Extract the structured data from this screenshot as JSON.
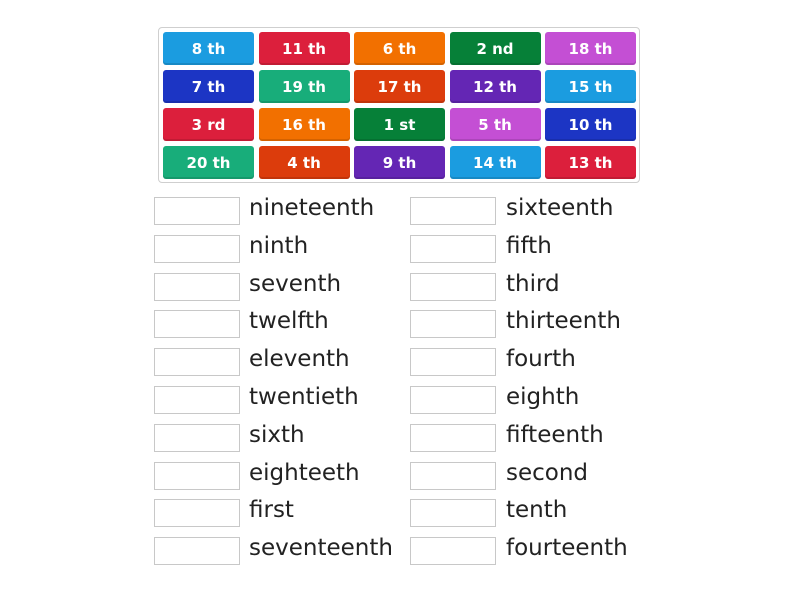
{
  "tiles": [
    {
      "label": "8 th",
      "color": "#1b9ce0"
    },
    {
      "label": "11 th",
      "color": "#dc1f3c"
    },
    {
      "label": "6 th",
      "color": "#f27000"
    },
    {
      "label": "2 nd",
      "color": "#068038"
    },
    {
      "label": "18 th",
      "color": "#c44fd4"
    },
    {
      "label": "7 th",
      "color": "#1c35c4"
    },
    {
      "label": "19 th",
      "color": "#18ad7a"
    },
    {
      "label": "17 th",
      "color": "#dc3c0c"
    },
    {
      "label": "12 th",
      "color": "#6426b4"
    },
    {
      "label": "15 th",
      "color": "#1b9ce0"
    },
    {
      "label": "3 rd",
      "color": "#dc1f3c"
    },
    {
      "label": "16 th",
      "color": "#f27000"
    },
    {
      "label": "1 st",
      "color": "#068038"
    },
    {
      "label": "5 th",
      "color": "#c44fd4"
    },
    {
      "label": "10 th",
      "color": "#1c35c4"
    },
    {
      "label": "20 th",
      "color": "#18ad7a"
    },
    {
      "label": "4 th",
      "color": "#dc3c0c"
    },
    {
      "label": "9 th",
      "color": "#6426b4"
    },
    {
      "label": "14 th",
      "color": "#1b9ce0"
    },
    {
      "label": "13 th",
      "color": "#dc1f3c"
    }
  ],
  "left_words": [
    "nineteenth",
    "ninth",
    "seventh",
    "twelfth",
    "eleventh",
    "twentieth",
    "sixth",
    "eighteeth",
    "first",
    "seventeenth"
  ],
  "right_words": [
    "sixteenth",
    "fifth",
    "third",
    "thirteenth",
    "fourth",
    "eighth",
    "fifteenth",
    "second",
    "tenth",
    "fourteenth"
  ]
}
